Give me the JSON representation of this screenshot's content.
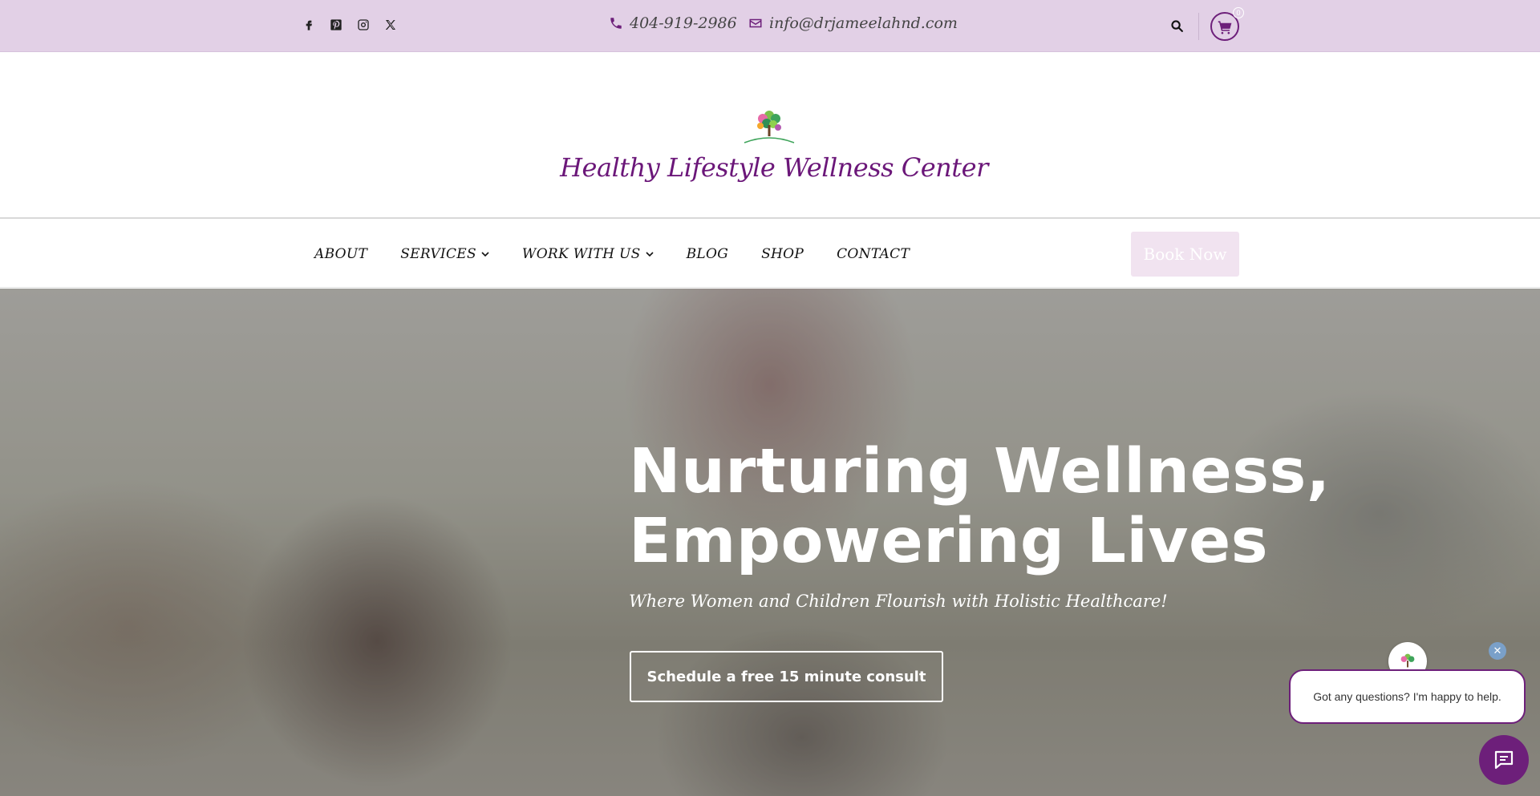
{
  "colors": {
    "brand_purple": "#6d1f7a",
    "topbar_bg": "#e2d0e6",
    "book_bg": "#f1e3f0"
  },
  "topbar": {
    "social_icons": [
      "facebook-icon",
      "pinterest-icon",
      "instagram-icon",
      "x-icon"
    ],
    "phone": "404-919-2986",
    "email": "info@drjameelahnd.com",
    "cart_count": "0"
  },
  "header": {
    "logo_text_top": "Healthy Lifestyle",
    "title": "Healthy Lifestyle Wellness Center"
  },
  "nav": {
    "items": [
      {
        "label": "ABOUT"
      },
      {
        "label": "SERVICES"
      },
      {
        "label": "WORK WITH US"
      },
      {
        "label": "BLOG"
      },
      {
        "label": "SHOP"
      },
      {
        "label": "CONTACT"
      }
    ],
    "book_label": "Book Now"
  },
  "hero": {
    "title_line1": "Nurturing Wellness,",
    "title_line2": "Empowering Lives",
    "subtitle": "Where Women and Children Flourish with Holistic Healthcare!",
    "cta_label": "Schedule a free 15 minute consult"
  },
  "chat": {
    "close_label": "✕",
    "message": "Got any questions? I'm happy to help."
  }
}
